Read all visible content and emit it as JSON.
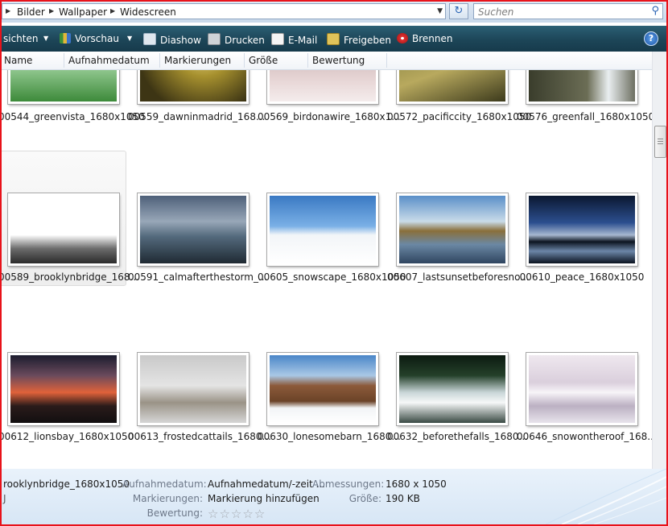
{
  "address": {
    "crumbs": [
      "Bilder",
      "Wallpaper",
      "Widescreen"
    ]
  },
  "search": {
    "placeholder": "Suchen"
  },
  "toolbar": {
    "ansichten": "sichten",
    "vorschau": "Vorschau",
    "diashow": "Diashow",
    "drucken": "Drucken",
    "email": "E-Mail",
    "freigeben": "Freigeben",
    "brennen": "Brennen",
    "help": "?"
  },
  "columns": [
    "Name",
    "Aufnahmedatum",
    "Markierungen",
    "Größe",
    "Bewertung"
  ],
  "files": [
    {
      "label": "00544_greenvista_1680x1050"
    },
    {
      "label": "00559_dawninmadrid_168..."
    },
    {
      "label": "00569_birdonawire_1680x1..."
    },
    {
      "label": "00572_pacificcity_1680x1050"
    },
    {
      "label": "00576_greenfall_1680x1050"
    },
    {
      "label": "00589_brooklynbridge_168..."
    },
    {
      "label": "00591_calmafterthestorm_..."
    },
    {
      "label": "00605_snowscape_1680x1050"
    },
    {
      "label": "00607_lastsunsetbeforesno..."
    },
    {
      "label": "00610_peace_1680x1050"
    },
    {
      "label": "00612_lionsbay_1680x1050"
    },
    {
      "label": "00613_frostedcattails_1680..."
    },
    {
      "label": "00630_lonesomebarn_1680..."
    },
    {
      "label": "00632_beforethefalls_1680..."
    },
    {
      "label": "00646_snowontheroof_168..."
    }
  ],
  "details": {
    "filename": "rooklynbridge_1680x1050",
    "aufnahmedatum_label": "Aufnahmedatum:",
    "aufnahmedatum_value": "Aufnahmedatum/-zeit ...",
    "markierungen_label": "Markierungen:",
    "markierungen_value": "Markierung hinzufügen",
    "bewertung_label": "Bewertung:",
    "rating": 0,
    "abmessungen_label": "Abmessungen:",
    "abmessungen_value": "1680 x 1050",
    "groesse_label": "Größe:",
    "groesse_value": "190 KB",
    "side_char": "J"
  }
}
